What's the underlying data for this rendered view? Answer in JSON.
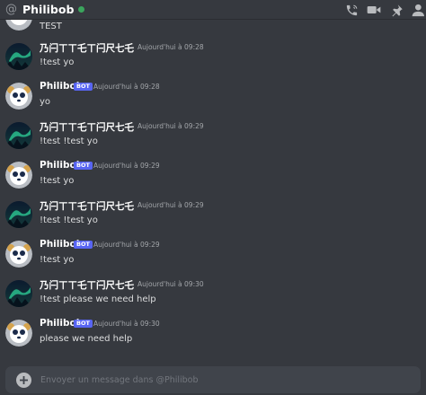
{
  "header": {
    "at_symbol": "@",
    "title": "Philibob",
    "status_color": "#3ba55d",
    "icons": [
      "call-icon",
      "video-icon",
      "pin-icon",
      "add-friend-icon"
    ]
  },
  "partial_message": {
    "text": "TEST"
  },
  "messages": [
    {
      "author": "乃闩ㄒㄒ乇ㄒ闩尺七乇",
      "bot": false,
      "timestamp": "Aujourd'hui à 09:28",
      "text": "!test yo",
      "avatar": "aurora-avatar"
    },
    {
      "author": "Philibob",
      "bot": true,
      "badge": "BOT",
      "timestamp": "Aujourd'hui à 09:28",
      "text": "yo",
      "avatar": "panda-avatar"
    },
    {
      "author": "乃闩ㄒㄒ乇ㄒ闩尺七乇",
      "bot": false,
      "timestamp": "Aujourd'hui à 09:29",
      "text": "!test !test yo",
      "avatar": "aurora-avatar"
    },
    {
      "author": "Philibob",
      "bot": true,
      "badge": "BOT",
      "timestamp": "Aujourd'hui à 09:29",
      "text": "!test yo",
      "avatar": "panda-avatar"
    },
    {
      "author": "乃闩ㄒㄒ乇ㄒ闩尺七乇",
      "bot": false,
      "timestamp": "Aujourd'hui à 09:29",
      "text": "!test !test yo",
      "avatar": "aurora-avatar"
    },
    {
      "author": "Philibob",
      "bot": true,
      "badge": "BOT",
      "timestamp": "Aujourd'hui à 09:29",
      "text": "!test yo",
      "avatar": "panda-avatar"
    },
    {
      "author": "乃闩ㄒㄒ乇ㄒ闩尺七乇",
      "bot": false,
      "timestamp": "Aujourd'hui à 09:30",
      "text": "!test please we need help",
      "avatar": "aurora-avatar"
    },
    {
      "author": "Philibob",
      "bot": true,
      "badge": "BOT",
      "timestamp": "Aujourd'hui à 09:30",
      "text": "please we need help",
      "avatar": "panda-avatar"
    }
  ],
  "composer": {
    "placeholder": "Envoyer un message dans @Philibob",
    "value": ""
  }
}
